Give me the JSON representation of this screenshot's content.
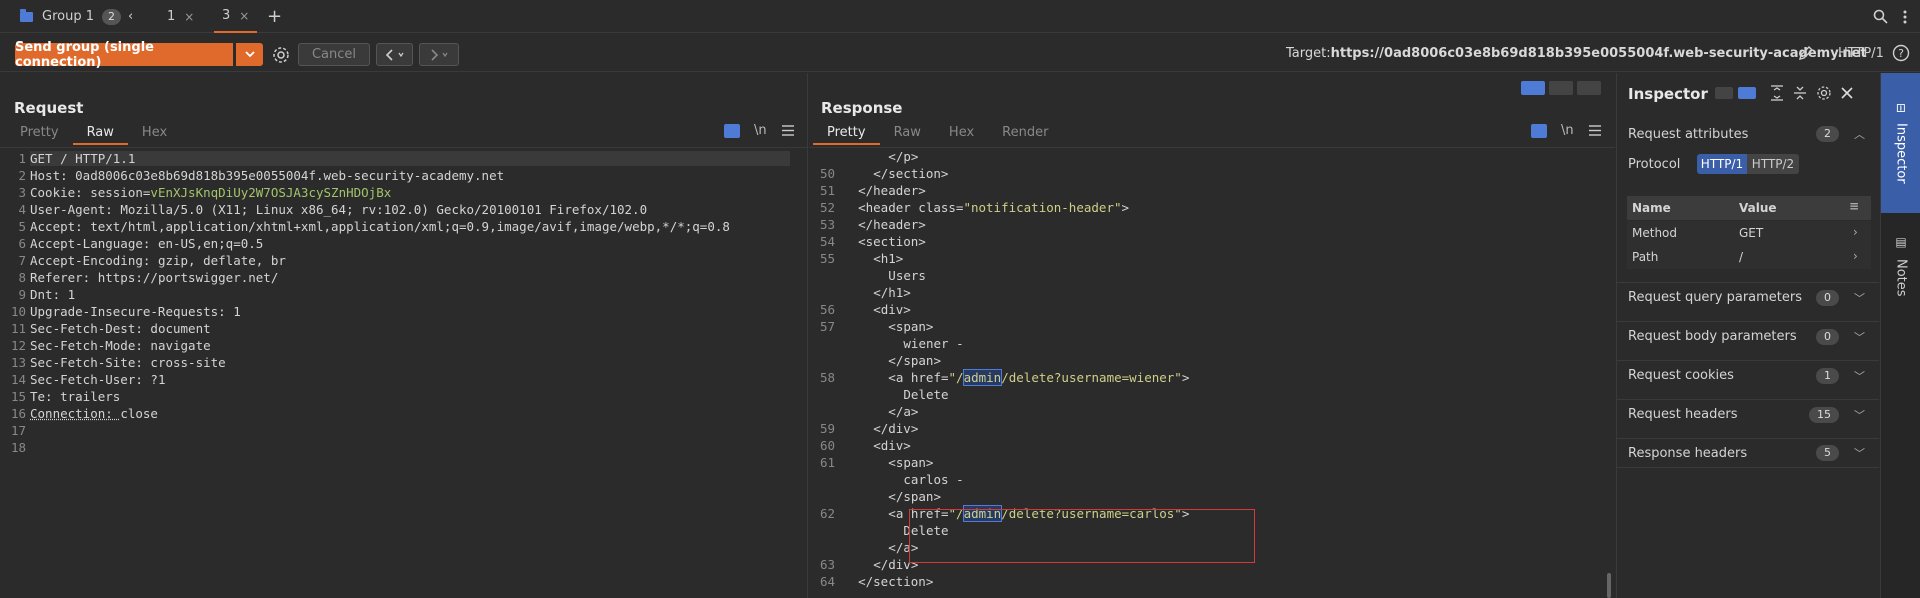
{
  "tabs": {
    "group_label": "Group 1",
    "group_count": "2",
    "tab1": "1",
    "tab2": "3",
    "close": "×",
    "add": "+",
    "prev": "‹"
  },
  "toolbar": {
    "send_label": "Send group (single connection)",
    "cancel_label": "Cancel",
    "target_prefix": "Target: ",
    "target_url": "https://0ad8006c03e8b69d818b395e0055004f.web-security-academy.net",
    "protocol": "HTTP/1"
  },
  "request": {
    "title": "Request",
    "subtabs": [
      "Pretty",
      "Raw",
      "Hex"
    ],
    "active_subtab": "Raw",
    "lines": [
      {
        "n": "1",
        "k": "GET / HTTP/1.1",
        "v": ""
      },
      {
        "n": "2",
        "k": "Host: ",
        "v": "0ad8006c03e8b69d818b395e0055004f.web-security-academy.net"
      },
      {
        "n": "3",
        "k": "Cookie: session=",
        "v": "vEnXJsKnqDiUy2W7OSJA3cySZnHDOjBx"
      },
      {
        "n": "4",
        "k": "User-Agent: ",
        "v": "Mozilla/5.0 (X11; Linux x86_64; rv:102.0) Gecko/20100101 Firefox/102.0"
      },
      {
        "n": "5",
        "k": "Accept: ",
        "v": "text/html,application/xhtml+xml,application/xml;q=0.9,image/avif,image/webp,*/*;q=0.8"
      },
      {
        "n": "6",
        "k": "Accept-Language: ",
        "v": "en-US,en;q=0.5"
      },
      {
        "n": "7",
        "k": "Accept-Encoding: ",
        "v": "gzip, deflate, br"
      },
      {
        "n": "8",
        "k": "Referer: ",
        "v": "https://portswigger.net/"
      },
      {
        "n": "9",
        "k": "Dnt: ",
        "v": "1"
      },
      {
        "n": "10",
        "k": "Upgrade-Insecure-Requests: ",
        "v": "1"
      },
      {
        "n": "11",
        "k": "Sec-Fetch-Dest: ",
        "v": "document"
      },
      {
        "n": "12",
        "k": "Sec-Fetch-Mode: ",
        "v": "navigate"
      },
      {
        "n": "13",
        "k": "Sec-Fetch-Site: ",
        "v": "cross-site"
      },
      {
        "n": "14",
        "k": "Sec-Fetch-User: ",
        "v": "?1"
      },
      {
        "n": "15",
        "k": "Te: ",
        "v": "trailers"
      },
      {
        "n": "16",
        "k": "Connection: ",
        "v": "close"
      },
      {
        "n": "17",
        "k": "",
        "v": ""
      },
      {
        "n": "18",
        "k": "",
        "v": ""
      }
    ]
  },
  "response": {
    "title": "Response",
    "subtabs": [
      "Pretty",
      "Raw",
      "Hex",
      "Render"
    ],
    "active_subtab": "Pretty",
    "lines": [
      {
        "n": "",
        "indent": 6,
        "a": "</p>",
        "b": "",
        "c": ""
      },
      {
        "n": "50",
        "indent": 4,
        "a": "</section>",
        "b": "",
        "c": ""
      },
      {
        "n": "51",
        "indent": 2,
        "a": "</header>",
        "b": "",
        "c": ""
      },
      {
        "n": "52",
        "indent": 2,
        "a": "<header class=",
        "b": "\"notification-header\"",
        "c": ">"
      },
      {
        "n": "53",
        "indent": 2,
        "a": "</header>",
        "b": "",
        "c": ""
      },
      {
        "n": "54",
        "indent": 2,
        "a": "<section>",
        "b": "",
        "c": ""
      },
      {
        "n": "55",
        "indent": 4,
        "a": "<h1>",
        "b": "",
        "c": ""
      },
      {
        "n": "",
        "indent": 6,
        "a": "Users",
        "b": "",
        "c": ""
      },
      {
        "n": "",
        "indent": 4,
        "a": "</h1>",
        "b": "",
        "c": ""
      },
      {
        "n": "56",
        "indent": 4,
        "a": "<div>",
        "b": "",
        "c": ""
      },
      {
        "n": "57",
        "indent": 6,
        "a": "<span>",
        "b": "",
        "c": ""
      },
      {
        "n": "",
        "indent": 8,
        "a": "wiener -",
        "b": "",
        "c": ""
      },
      {
        "n": "",
        "indent": 6,
        "a": "</span>",
        "b": "",
        "c": ""
      },
      {
        "n": "58",
        "indent": 6,
        "a": "<a href=",
        "b": "\"/admin/delete?username=wiener\"",
        "c": ">"
      },
      {
        "n": "",
        "indent": 8,
        "a": "Delete",
        "b": "",
        "c": ""
      },
      {
        "n": "",
        "indent": 6,
        "a": "</a>",
        "b": "",
        "c": ""
      },
      {
        "n": "59",
        "indent": 4,
        "a": "</div>",
        "b": "",
        "c": ""
      },
      {
        "n": "60",
        "indent": 4,
        "a": "<div>",
        "b": "",
        "c": ""
      },
      {
        "n": "61",
        "indent": 6,
        "a": "<span>",
        "b": "",
        "c": ""
      },
      {
        "n": "",
        "indent": 8,
        "a": "carlos -",
        "b": "",
        "c": ""
      },
      {
        "n": "",
        "indent": 6,
        "a": "</span>",
        "b": "",
        "c": ""
      },
      {
        "n": "62",
        "indent": 6,
        "a": "<a href=",
        "b": "\"/admin/delete?username=carlos\"",
        "c": ">"
      },
      {
        "n": "",
        "indent": 8,
        "a": "Delete",
        "b": "",
        "c": ""
      },
      {
        "n": "",
        "indent": 6,
        "a": "</a>",
        "b": "",
        "c": ""
      },
      {
        "n": "63",
        "indent": 4,
        "a": "</div>",
        "b": "",
        "c": ""
      },
      {
        "n": "64",
        "indent": 2,
        "a": "</section>",
        "b": "",
        "c": ""
      }
    ]
  },
  "inspector": {
    "title": "Inspector",
    "request_attributes": {
      "label": "Request attributes",
      "count": "2"
    },
    "protocol_label": "Protocol",
    "protocol_options": [
      "HTTP/1",
      "HTTP/2"
    ],
    "table_headers": [
      "Name",
      "Value"
    ],
    "rows": [
      {
        "name": "Method",
        "value": "GET"
      },
      {
        "name": "Path",
        "value": "/"
      }
    ],
    "sections": [
      {
        "label": "Request query parameters",
        "count": "0"
      },
      {
        "label": "Request body parameters",
        "count": "0"
      },
      {
        "label": "Request cookies",
        "count": "1"
      },
      {
        "label": "Request headers",
        "count": "15"
      },
      {
        "label": "Response headers",
        "count": "5"
      }
    ]
  },
  "rail": {
    "inspector_label": "Inspector",
    "notes_label": "Notes"
  },
  "editor_nl_label": "\\n",
  "colors": {
    "accent": "#e06a2b",
    "selection_blue": "#4d7bd6",
    "highlight_box": "#d23a3a",
    "cookie_value": "#a3c46a",
    "string_value": "#cfcf8a"
  }
}
